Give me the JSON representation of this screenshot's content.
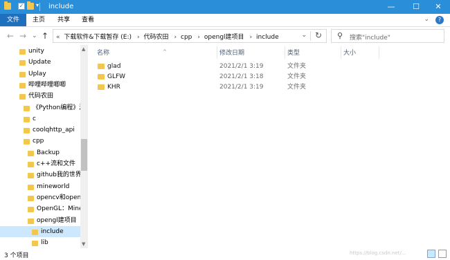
{
  "window": {
    "title": "include",
    "minimize": "—",
    "maximize": "☐",
    "close": "✕",
    "title_bar_color": "#2b8ed9"
  },
  "ribbon": {
    "tabs": [
      "文件",
      "主页",
      "共享",
      "查看"
    ],
    "expand": "⌄",
    "help": "?"
  },
  "nav": {
    "back": "←",
    "forward": "→",
    "recent": "⌄",
    "up": "↑"
  },
  "address": {
    "prefix": "«",
    "crumbs": [
      "下载软件&下载暂存 (E:)",
      "代码农田",
      "cpp",
      "opengl建项目",
      "include"
    ],
    "separator": "›",
    "dropdown": "⌄",
    "refresh": "↻"
  },
  "search": {
    "placeholder": "搜索\"include\"",
    "icon": "search-icon"
  },
  "sidebar": {
    "items": [
      {
        "label": "unity",
        "indent": 0
      },
      {
        "label": "Update",
        "indent": 0
      },
      {
        "label": "Uplay",
        "indent": 0
      },
      {
        "label": "哔哩哔哩唧唧",
        "indent": 0
      },
      {
        "label": "代码农田",
        "indent": 0
      },
      {
        "label": "《Python编程》源",
        "indent": 1
      },
      {
        "label": "c",
        "indent": 1
      },
      {
        "label": "coolqhttp_api",
        "indent": 1
      },
      {
        "label": "cpp",
        "indent": 1
      },
      {
        "label": "Backup",
        "indent": 2
      },
      {
        "label": "c++流和文件",
        "indent": 2
      },
      {
        "label": "github我的世界我",
        "indent": 2
      },
      {
        "label": "mineworld",
        "indent": 2
      },
      {
        "label": "opencv和opengl",
        "indent": 2
      },
      {
        "label": "OpenGL：Minecraft",
        "indent": 2
      },
      {
        "label": "opengl建项目",
        "indent": 2
      },
      {
        "label": "include",
        "indent": 3,
        "selected": true
      },
      {
        "label": "lib",
        "indent": 3
      }
    ]
  },
  "columns": {
    "name": "名称",
    "modified": "修改日期",
    "type": "类型",
    "size": "大小",
    "sort_arrow": "^"
  },
  "files": [
    {
      "name": "glad",
      "modified": "2021/2/1 3:19",
      "type": "文件夹"
    },
    {
      "name": "GLFW",
      "modified": "2021/2/1 3:18",
      "type": "文件夹"
    },
    {
      "name": "KHR",
      "modified": "2021/2/1 3:19",
      "type": "文件夹"
    }
  ],
  "status": {
    "count": "3 个项目",
    "watermark": "https://blog.csdn.net/..."
  }
}
